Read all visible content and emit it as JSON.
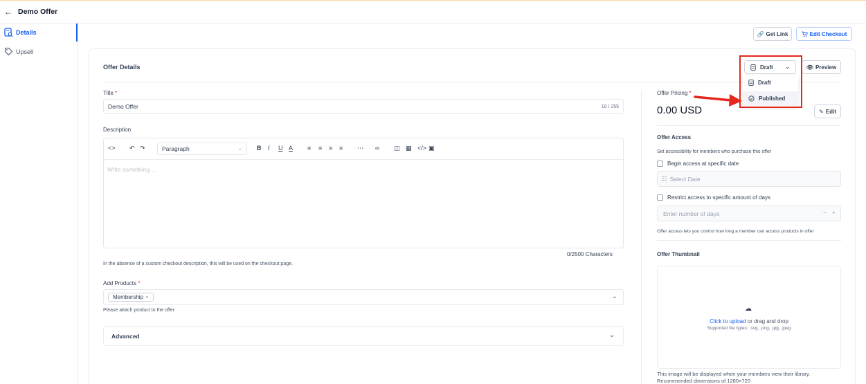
{
  "header": {
    "back_icon": "arrow-left-icon",
    "title": "Demo Offer"
  },
  "sidebar": {
    "items": [
      {
        "label": "Details",
        "icon": "document-search-icon",
        "active": true
      },
      {
        "label": "Upsell",
        "icon": "tag-icon",
        "active": false
      }
    ]
  },
  "actions": {
    "get_link": "Get Link",
    "edit_checkout": "Edit Checkout"
  },
  "card": {
    "title": "Offer Details",
    "status_selected": "Draft",
    "preview_label": "Preview",
    "status_options": [
      "Draft",
      "Published"
    ]
  },
  "form": {
    "title_label": "Title",
    "title_value": "Demo Offer",
    "title_counter": "10 / 255",
    "description_label": "Description",
    "paragraph_label": "Paragraph",
    "description_placeholder": "Write something ...",
    "char_counter": "0/2500 Characters",
    "description_hint": "In the absence of a custom checkout description, this will be used on the checkout page.",
    "products_label": "Add Products",
    "product_chip": "Membership",
    "products_hint": "Please attach product to the offer",
    "advanced_label": "Advanced"
  },
  "pricing": {
    "label": "Offer Pricing",
    "value": "0.00 USD",
    "edit_label": "Edit"
  },
  "access": {
    "title": "Offer Access",
    "subtitle": "Set accessibility for members who purchase this offer",
    "begin_label": "Begin access at specific date",
    "date_placeholder": "Select Date",
    "restrict_label": "Restrict access to specific amount of days",
    "days_placeholder": "Enter number of days",
    "footer": "Offer access lets you control how long a member can access products in offer"
  },
  "thumbnail": {
    "title": "Offer Thumbnail",
    "upload_link": "Click to upload",
    "upload_rest": " or drag and drop",
    "file_types": "Supported file types: .svg, .png, .jpg, .jpeg",
    "note1": "This image will be displayed when your members view their library.",
    "note2": "Recommended dimensions of 1280×720"
  },
  "colors": {
    "accent": "#155eef",
    "annotation": "#e5281b"
  }
}
